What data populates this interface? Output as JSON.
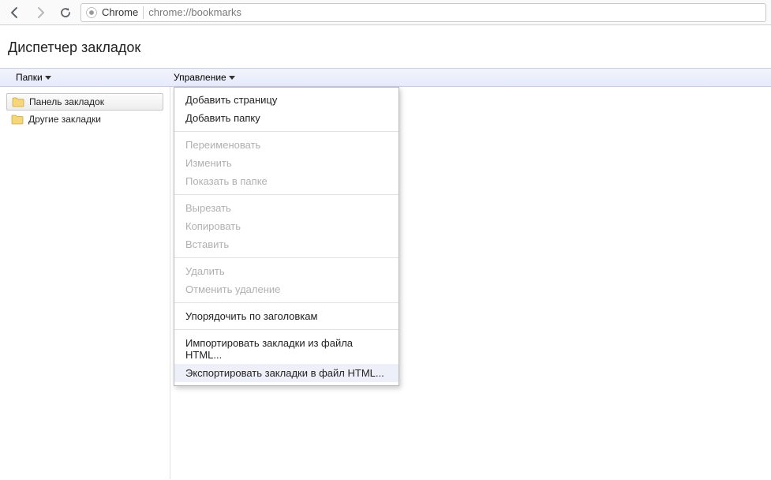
{
  "browser": {
    "chrome_label": "Chrome",
    "url": "chrome://bookmarks"
  },
  "page": {
    "title": "Диспетчер закладок"
  },
  "columns": {
    "left": "Папки",
    "right": "Управление"
  },
  "sidebar": {
    "items": [
      {
        "label": "Панель закладок",
        "selected": true
      },
      {
        "label": "Другие закладки",
        "selected": false
      }
    ]
  },
  "menu": {
    "groups": [
      [
        {
          "label": "Добавить страницу",
          "enabled": true
        },
        {
          "label": "Добавить папку",
          "enabled": true
        }
      ],
      [
        {
          "label": "Переименовать",
          "enabled": false
        },
        {
          "label": "Изменить",
          "enabled": false
        },
        {
          "label": "Показать в папке",
          "enabled": false
        }
      ],
      [
        {
          "label": "Вырезать",
          "enabled": false
        },
        {
          "label": "Копировать",
          "enabled": false
        },
        {
          "label": "Вставить",
          "enabled": false
        }
      ],
      [
        {
          "label": "Удалить",
          "enabled": false
        },
        {
          "label": "Отменить удаление",
          "enabled": false
        }
      ],
      [
        {
          "label": "Упорядочить по заголовкам",
          "enabled": true
        }
      ],
      [
        {
          "label": "Импортировать закладки из файла HTML...",
          "enabled": true
        },
        {
          "label": "Экспортировать закладки в файл HTML...",
          "enabled": true,
          "highlighted": true
        }
      ]
    ]
  }
}
